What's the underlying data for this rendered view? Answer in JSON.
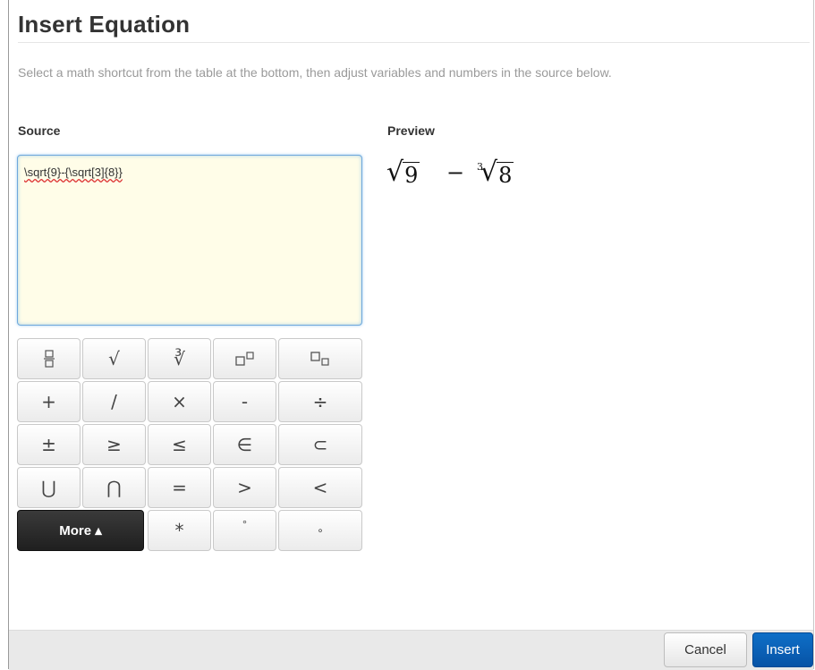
{
  "dialog": {
    "title": "Insert Equation",
    "instructions": "Select a math shortcut from the table at the bottom, then adjust variables and numbers in the source below."
  },
  "source": {
    "label": "Source",
    "value": "\\sqrt{9}-{\\sqrt[3]{8}}"
  },
  "preview": {
    "label": "Preview",
    "radicand_1": "9",
    "minus": "−",
    "root_index": "3",
    "radicand_2": "8"
  },
  "keypad": {
    "rows": [
      [
        "fraction",
        "square-root",
        "cube-root",
        "superscript",
        "subscript"
      ],
      [
        "+",
        "/",
        "×",
        "-",
        "÷"
      ],
      [
        "±",
        "≥",
        "≤",
        "∈",
        "⊂"
      ],
      [
        "⋃",
        "⋂",
        "=",
        ">",
        "<"
      ],
      [
        "More",
        "*",
        "°",
        "∘"
      ]
    ],
    "r1": {
      "sqrt": "√",
      "cbrt": "∛"
    },
    "r2": {
      "plus": "+",
      "slash": "/",
      "times": "×",
      "minus": "-",
      "divide": "÷"
    },
    "r3": {
      "plusminus": "±",
      "geq": "≥",
      "leq": "≤",
      "in": "∈",
      "subset": "⊂"
    },
    "r4": {
      "union": "⋃",
      "intersect": "⋂",
      "equals": "=",
      "gt": ">",
      "lt": "<"
    },
    "r5": {
      "more": "More ▴",
      "asterisk": "*",
      "degree": "°",
      "compose": "∘"
    }
  },
  "footer": {
    "cancel_label": "Cancel",
    "insert_label": "Insert"
  },
  "colors": {
    "insert_button": "#0a62b8",
    "source_bg": "#fffde8",
    "more_button": "#2b2b2b"
  }
}
